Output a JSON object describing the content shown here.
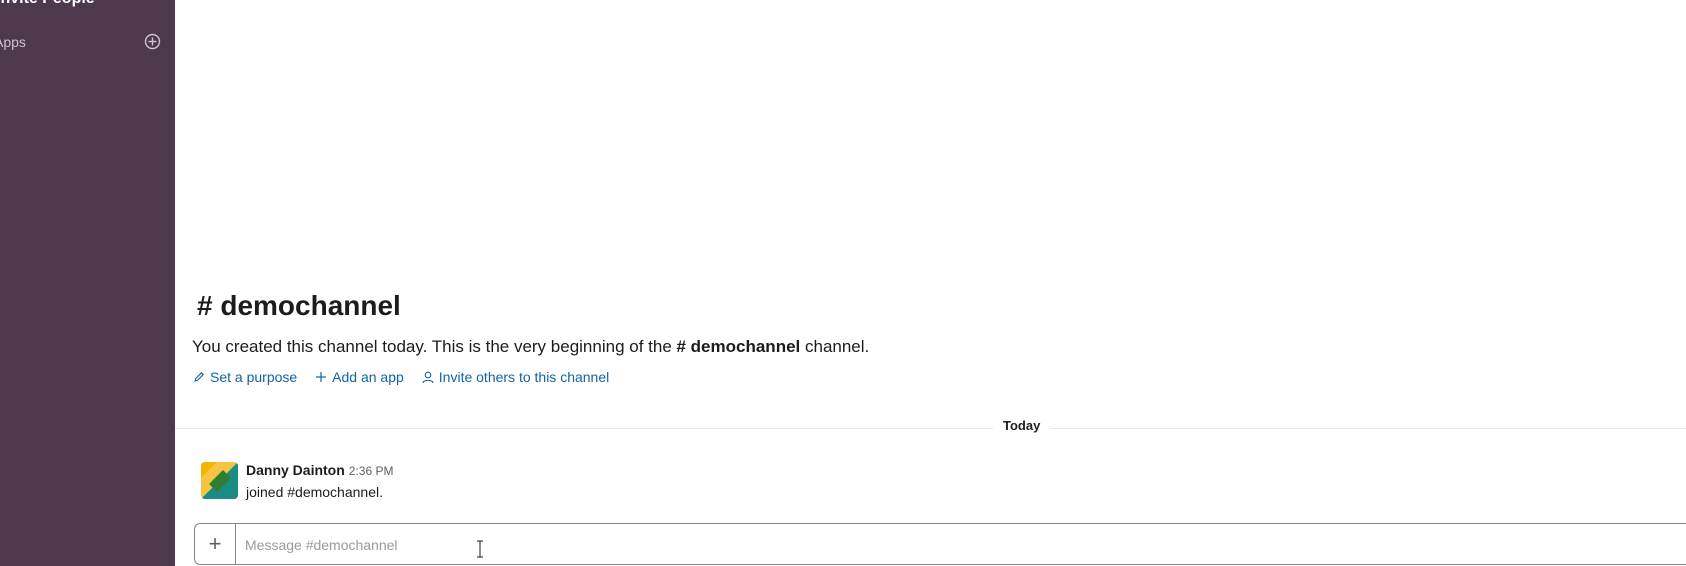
{
  "sidebar": {
    "invite_label": "Invite People",
    "section_label": "Apps",
    "add_icon": "plus-circle-icon"
  },
  "channel": {
    "title": "# demochannel",
    "intro_prefix": "You created this channel today. This is the very beginning of the ",
    "intro_channel": "# demochannel",
    "intro_suffix": " channel.",
    "actions": [
      {
        "icon": "pencil-icon",
        "label": "Set a purpose"
      },
      {
        "icon": "plus-icon",
        "label": "Add an app"
      },
      {
        "icon": "person-icon",
        "label": "Invite others to this channel"
      }
    ]
  },
  "divider": {
    "label": "Today"
  },
  "message": {
    "author": "Danny Dainton",
    "time": "2:36 PM",
    "text": "joined #demochannel."
  },
  "composer": {
    "plus_label": "+",
    "placeholder": "Message #demochannel"
  },
  "colors": {
    "sidebar_bg": "#4d394b",
    "link": "#1264a3"
  }
}
